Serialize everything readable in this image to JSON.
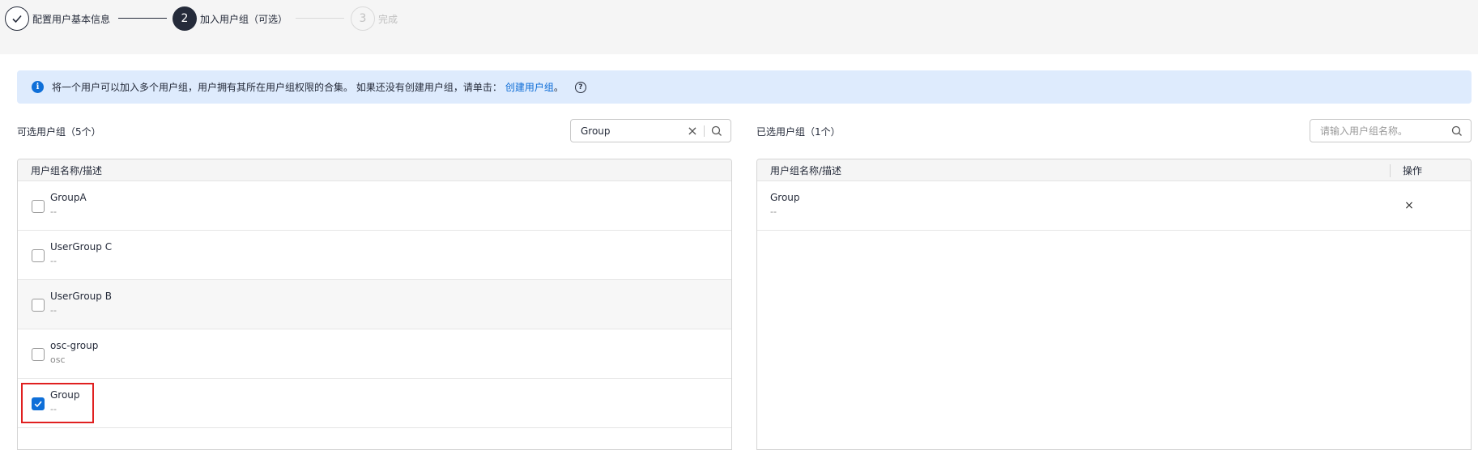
{
  "stepper": {
    "steps": [
      {
        "number": "",
        "label": "配置用户基本信息",
        "state": "done"
      },
      {
        "number": "2",
        "label": "加入用户组（可选）",
        "state": "active"
      },
      {
        "number": "3",
        "label": "完成",
        "state": "pending"
      }
    ]
  },
  "info": {
    "text": "将一个用户可以加入多个用户组，用户拥有其所在用户组权限的合集。 如果还没有创建用户组，请单击：",
    "link": "创建用户组",
    "tail": "。"
  },
  "available": {
    "title": "可选用户组（5个）",
    "search_value": "Group",
    "column_header": "用户组名称/描述",
    "rows": [
      {
        "name": "GroupA",
        "desc": "--",
        "checked": false
      },
      {
        "name": "UserGroup C",
        "desc": "--",
        "checked": false
      },
      {
        "name": "UserGroup B",
        "desc": "--",
        "checked": false
      },
      {
        "name": "osc-group",
        "desc": "osc",
        "checked": false
      },
      {
        "name": "Group",
        "desc": "--",
        "checked": true
      }
    ]
  },
  "selected": {
    "title": "已选用户组（1个）",
    "search_placeholder": "请输入用户组名称。",
    "column_header": "用户组名称/描述",
    "action_header": "操作",
    "rows": [
      {
        "name": "Group",
        "desc": "--"
      }
    ]
  },
  "colors": {
    "primary": "#0f6fd8",
    "dark": "#252b3a",
    "info_bg": "#deebfd",
    "highlight": "#e02020"
  }
}
